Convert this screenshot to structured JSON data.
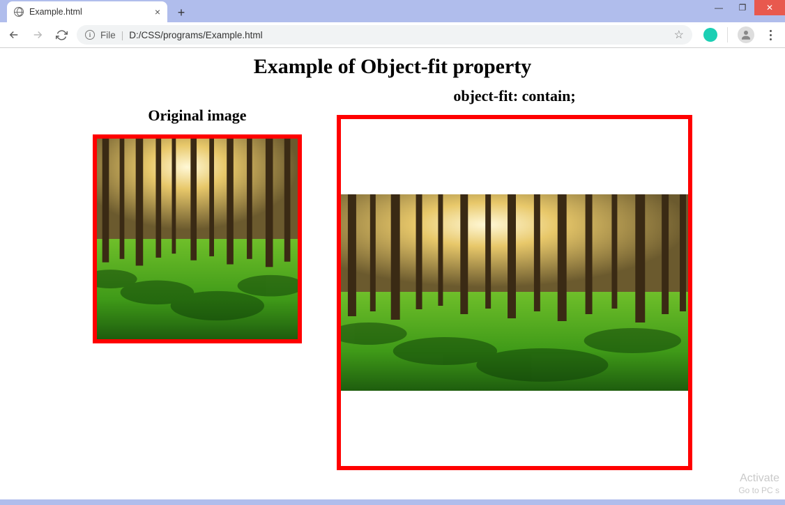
{
  "window": {
    "tab_title": "Example.html",
    "minimize": "—",
    "maximize": "❐",
    "close": "✕",
    "new_tab": "+"
  },
  "toolbar": {
    "file_label": "File",
    "url_path": "D:/CSS/programs/Example.html",
    "info_glyph": "i",
    "separator": "|"
  },
  "page": {
    "heading": "Example of Object-fit property",
    "original_label": "Original image",
    "contain_label": "object-fit: contain;"
  },
  "watermark": {
    "line1": "Activate",
    "line2": "Go to PC s"
  }
}
